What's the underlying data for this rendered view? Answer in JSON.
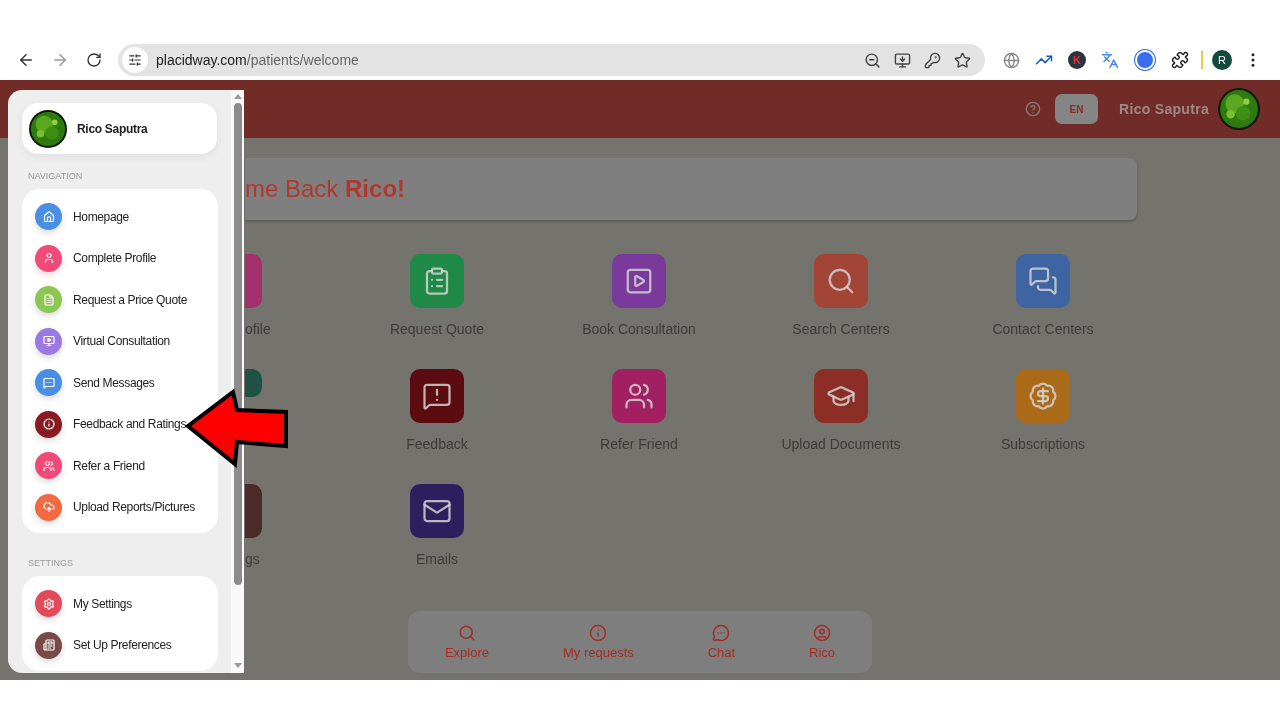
{
  "browser": {
    "url_host": "placidway.com",
    "url_path": "/patients/welcome",
    "extension_letter": "K",
    "profile_initial": "R"
  },
  "header": {
    "language": "EN",
    "user_name": "Rico Saputra"
  },
  "banner": {
    "greeting": "me Back **Rico!**"
  },
  "tiles": [
    {
      "kind": "stub",
      "label": "ofile",
      "color": "#a3306c"
    },
    {
      "kind": "full",
      "label": "Request Quote",
      "color": "#1f8a47"
    },
    {
      "kind": "full",
      "label": "Book Consultation",
      "color": "#7a3a9c"
    },
    {
      "kind": "full",
      "label": "Search Centers",
      "color": "#a24436"
    },
    {
      "kind": "full",
      "label": "Contact Centers",
      "color": "#3f64a2"
    },
    {
      "kind": "covered",
      "color": "#1f5242"
    },
    {
      "kind": "full",
      "label": "Feedback",
      "color": "#5a0c10"
    },
    {
      "kind": "full",
      "label": "Refer Friend",
      "color": "#a22062"
    },
    {
      "kind": "full",
      "label": "Upload Documents",
      "color": "#8c2e26"
    },
    {
      "kind": "full",
      "label": "Subscriptions",
      "color": "#aa6a18"
    },
    {
      "kind": "stub",
      "label": "gs",
      "color": "#4c2a2a"
    },
    {
      "kind": "full",
      "label": "Emails",
      "color": "#2c1f5e"
    }
  ],
  "bottom_nav": [
    {
      "label": "Explore"
    },
    {
      "label": "My requests"
    },
    {
      "label": "Chat"
    },
    {
      "label": "Rico"
    }
  ],
  "drawer": {
    "user_name": "Rico Saputra",
    "sections": [
      {
        "title": "NAVIGATION",
        "items": [
          {
            "label": "Homepage",
            "color": "#4a8fe3"
          },
          {
            "label": "Complete Profile",
            "color": "#f24a78"
          },
          {
            "label": "Request a Price Quote",
            "color": "#8cc653"
          },
          {
            "label": "Virtual Consultation",
            "color": "#9a7ae2"
          },
          {
            "label": "Send Messages",
            "color": "#4a8fe3"
          },
          {
            "label": "Feedback and Ratings",
            "color": "#8a1a22"
          },
          {
            "label": "Refer a Friend",
            "color": "#f24a78"
          },
          {
            "label": "Upload Reports/Pictures",
            "color": "#f26a42"
          }
        ]
      },
      {
        "title": "SETTINGS",
        "items": [
          {
            "label": "My Settings",
            "color": "#e24a5a"
          },
          {
            "label": "Set Up Preferences",
            "color": "#7a4a48"
          }
        ]
      }
    ]
  }
}
